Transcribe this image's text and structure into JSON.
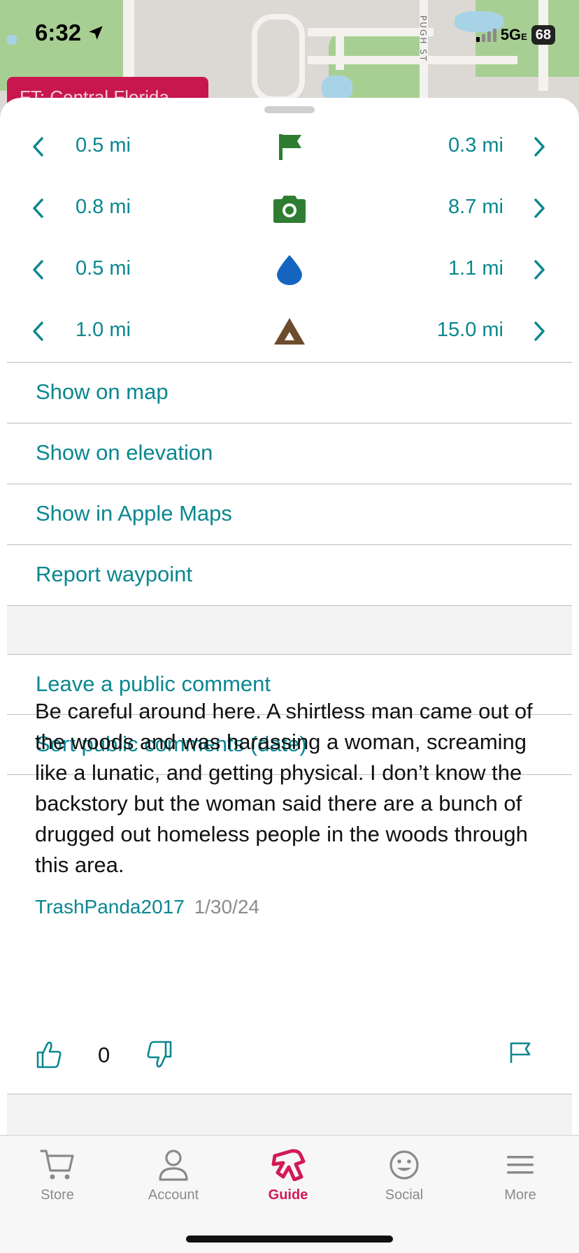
{
  "status_bar": {
    "time": "6:32",
    "network": "5G",
    "network_suffix": "E",
    "battery": "68"
  },
  "map": {
    "street_label": "PUGH ST",
    "banner": "FT: Central Florida"
  },
  "nav_rows": [
    {
      "icon": "flag-icon",
      "left": "0.5 mi",
      "right": "0.3 mi",
      "color": "#2e7d32"
    },
    {
      "icon": "camera-icon",
      "left": "0.8 mi",
      "right": "8.7 mi",
      "color": "#2e7d32"
    },
    {
      "icon": "water-drop-icon",
      "left": "0.5 mi",
      "right": "1.1 mi",
      "color": "#1565c0"
    },
    {
      "icon": "tent-icon",
      "left": "1.0 mi",
      "right": "15.0 mi",
      "color": "#6d4c2e"
    }
  ],
  "actions": {
    "show_on_map": "Show on map",
    "show_on_elevation": "Show on elevation",
    "show_in_apple_maps": "Show in Apple Maps",
    "report_waypoint": "Report waypoint",
    "leave_comment": "Leave a public comment",
    "sort_comments": "Sort public comments (date)"
  },
  "comment": {
    "text": "Be careful around here. A shirtless man came out of the woods and was harassing a woman, screaming like a lunatic, and getting physical. I don’t know the backstory but the woman said there are a bunch of drugged out homeless people in the woods through this area.",
    "author": "TrashPanda2017",
    "date": "1/30/24",
    "votes": "0"
  },
  "tabs": [
    {
      "label": "Store",
      "icon": "cart-icon"
    },
    {
      "label": "Account",
      "icon": "person-icon"
    },
    {
      "label": "Guide",
      "icon": "guide-logo-icon",
      "active": true
    },
    {
      "label": "Social",
      "icon": "smiley-icon"
    },
    {
      "label": "More",
      "icon": "menu-icon"
    }
  ],
  "colors": {
    "accent": "#0a8790",
    "brand": "#d31a55"
  }
}
